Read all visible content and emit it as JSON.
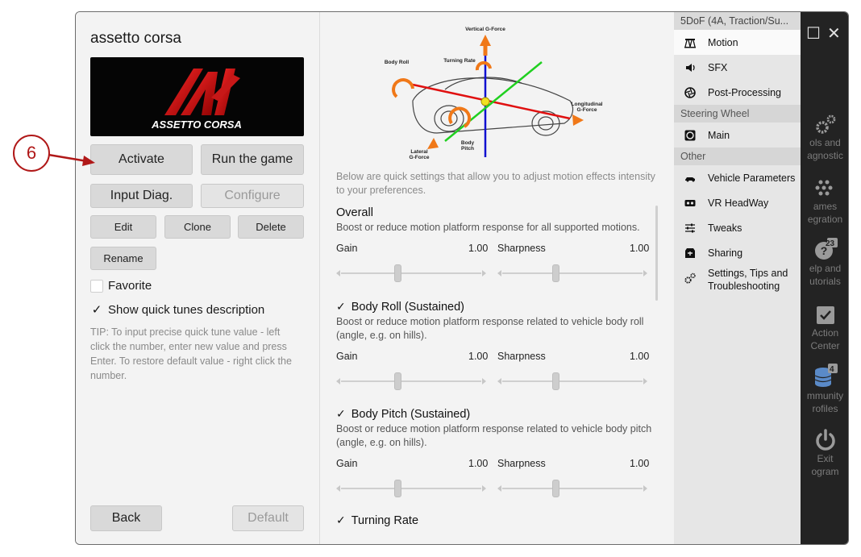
{
  "game": {
    "title": "assetto corsa",
    "logo_text": "ASSETTO CORSA"
  },
  "left_panel": {
    "activate": "Activate",
    "run_game": "Run the game",
    "input_diag": "Input Diag.",
    "configure": "Configure",
    "edit": "Edit",
    "clone": "Clone",
    "delete": "Delete",
    "rename": "Rename",
    "favorite": "Favorite",
    "show_quick_tunes": "Show quick tunes description",
    "tip": "TIP: To input precise quick tune value - left click the number, enter new value and press Enter. To restore default value - right click the number.",
    "back": "Back",
    "default": "Default"
  },
  "callout": {
    "number": "6"
  },
  "diagram": {
    "vertical": "Vertical G-Force",
    "turning": "Turning Rate",
    "body_roll": "Body Roll",
    "longitudinal": "Longitudinal",
    "longitudinal2": "G-Force",
    "lateral": "Lateral",
    "lateral2": "G-Force",
    "body_pitch": "Body",
    "body_pitch2": "Pitch"
  },
  "center": {
    "intro": "Below are quick settings that allow you to adjust motion effects intensity to your preferences.",
    "sections": [
      {
        "title": "Overall",
        "checked": false,
        "desc": "Boost or reduce motion platform response for all supported motions.",
        "gain_label": "Gain",
        "gain_value": "1.00",
        "sharpness_label": "Sharpness",
        "sharpness_value": "1.00"
      },
      {
        "title": "Body Roll (Sustained)",
        "checked": true,
        "desc": "Boost or reduce motion platform response related to vehicle body roll (angle, e.g. on hills).",
        "gain_label": "Gain",
        "gain_value": "1.00",
        "sharpness_label": "Sharpness",
        "sharpness_value": "1.00"
      },
      {
        "title": "Body Pitch (Sustained)",
        "checked": true,
        "desc": "Boost or reduce motion platform response related to vehicle body pitch (angle, e.g. on hills).",
        "gain_label": "Gain",
        "gain_value": "1.00",
        "sharpness_label": "Sharpness",
        "sharpness_value": "1.00"
      },
      {
        "title": "Turning Rate",
        "checked": true
      }
    ]
  },
  "menu": {
    "header_profile": "5DoF (4A, Traction/Su...",
    "motion": "Motion",
    "sfx": "SFX",
    "post_processing": "Post-Processing",
    "header_steering": "Steering Wheel",
    "main": "Main",
    "header_other": "Other",
    "vehicle_parameters": "Vehicle Parameters",
    "vr_headway": "VR HeadWay",
    "tweaks": "Tweaks",
    "sharing": "Sharing",
    "settings_tips": "Settings, Tips and Troubleshooting"
  },
  "dark_sidebar": {
    "tools_l1": "ols and",
    "tools_l2": "agnostic",
    "games_l1": "ames",
    "games_l2": "egration",
    "help_badge": "23",
    "help_l1": "elp and",
    "help_l2": "utorials",
    "action_l1": "Action",
    "action_l2": "Center",
    "community_badge": "4",
    "community_l1": "mmunity",
    "community_l2": "rofiles",
    "exit_l1": "Exit",
    "exit_l2": "ogram"
  },
  "colors": {
    "callout": "#b01818",
    "vertical_axis": "#1010d0",
    "longitudinal_axis": "#e01010",
    "lateral_axis": "#20d020",
    "arrows": "#f07818"
  }
}
